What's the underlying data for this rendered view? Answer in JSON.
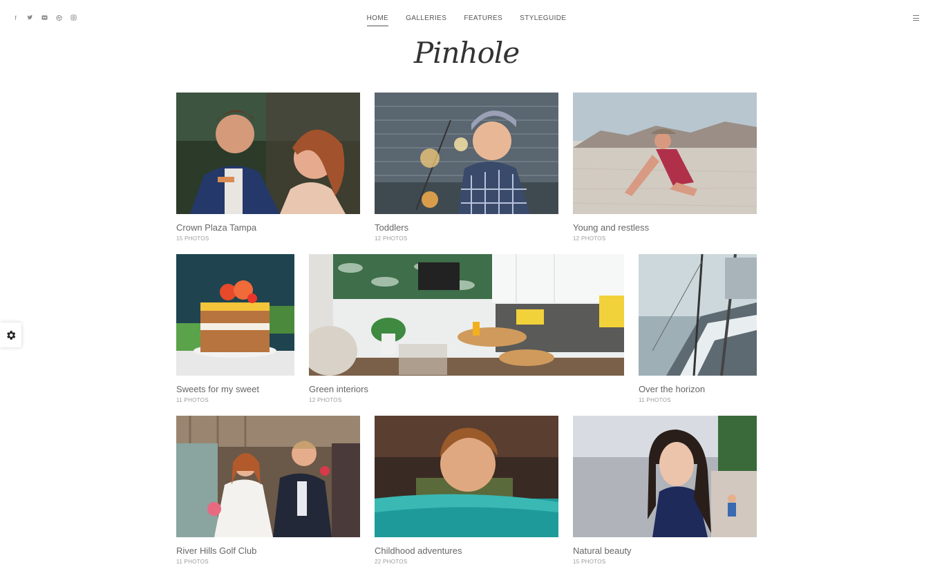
{
  "social": {
    "icons": [
      "facebook-icon",
      "twitter-icon",
      "flickr-icon",
      "dribbble-icon",
      "instagram-icon"
    ]
  },
  "nav": {
    "items": [
      {
        "label": "HOME",
        "active": true
      },
      {
        "label": "GALLERIES",
        "active": false
      },
      {
        "label": "FEATURES",
        "active": false
      },
      {
        "label": "STYLEGUIDE",
        "active": false
      }
    ]
  },
  "logo": "Pinhole",
  "galleries": [
    {
      "title": "Crown Plaza Tampa",
      "count": "15 PHOTOS"
    },
    {
      "title": "Toddlers",
      "count": "12 PHOTOS"
    },
    {
      "title": "Young and restless",
      "count": "12 PHOTOS"
    },
    {
      "title": "Sweets for my sweet",
      "count": "11 PHOTOS"
    },
    {
      "title": "Green interiors",
      "count": "12 PHOTOS"
    },
    {
      "title": "Over the horizon",
      "count": "11 PHOTOS"
    },
    {
      "title": "River Hills Golf Club",
      "count": "11 PHOTOS"
    },
    {
      "title": "Childhood adventures",
      "count": "22 PHOTOS"
    },
    {
      "title": "Natural beauty",
      "count": "15 PHOTOS"
    }
  ]
}
